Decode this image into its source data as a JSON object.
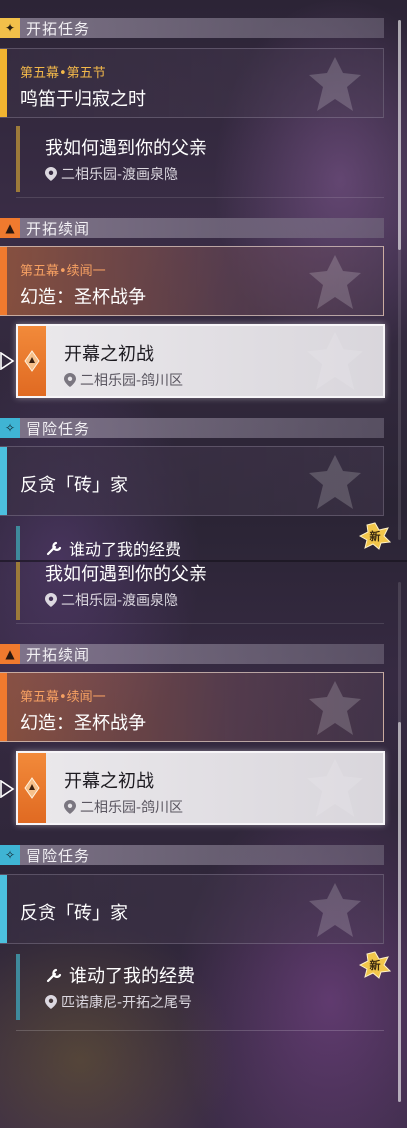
{
  "colors": {
    "trailblaze": "#f2b430",
    "companion": "#f07a2e",
    "adventure": "#4cc0de",
    "selected_bg": "#ebe9ec"
  },
  "panel_a": {
    "sections": {
      "trailblaze": {
        "title": "开拓任务",
        "icon": "trailblaze-mission-icon"
      },
      "companion": {
        "title": "开拓续闻",
        "icon": "companion-mission-icon"
      },
      "adventure": {
        "title": "冒险任务",
        "icon": "adventure-mission-icon"
      }
    },
    "trailblaze_main": {
      "chapter": "第五幕•第五节",
      "name": "鸣笛于归寂之时"
    },
    "trailblaze_sub": {
      "name": "我如何遇到你的父亲",
      "location": "二相乐园-渡画泉隐"
    },
    "companion_main": {
      "chapter": "第五幕•续闻一",
      "name": "幻造：圣杯战争"
    },
    "companion_sub": {
      "name": "开幕之初战",
      "location": "二相乐园-鸽川区"
    },
    "adventure_main": {
      "name": "反贪「砖」家"
    },
    "adventure_sub": {
      "name": "谁动了我的经费"
    },
    "new_badge": "新"
  },
  "panel_b": {
    "trailblaze_sub": {
      "name": "我如何遇到你的父亲",
      "location": "二相乐园-渡画泉隐"
    },
    "sections": {
      "companion": {
        "title": "开拓续闻",
        "icon": "companion-mission-icon"
      },
      "adventure": {
        "title": "冒险任务",
        "icon": "adventure-mission-icon"
      }
    },
    "companion_main": {
      "chapter": "第五幕•续闻一",
      "name": "幻造：圣杯战争"
    },
    "companion_sub": {
      "name": "开幕之初战",
      "location": "二相乐园-鸽川区"
    },
    "adventure_main": {
      "name": "反贪「砖」家"
    },
    "adventure_sub": {
      "name": "谁动了我的经费",
      "location": "匹诺康尼-开拓之尾号"
    },
    "new_badge": "新"
  }
}
